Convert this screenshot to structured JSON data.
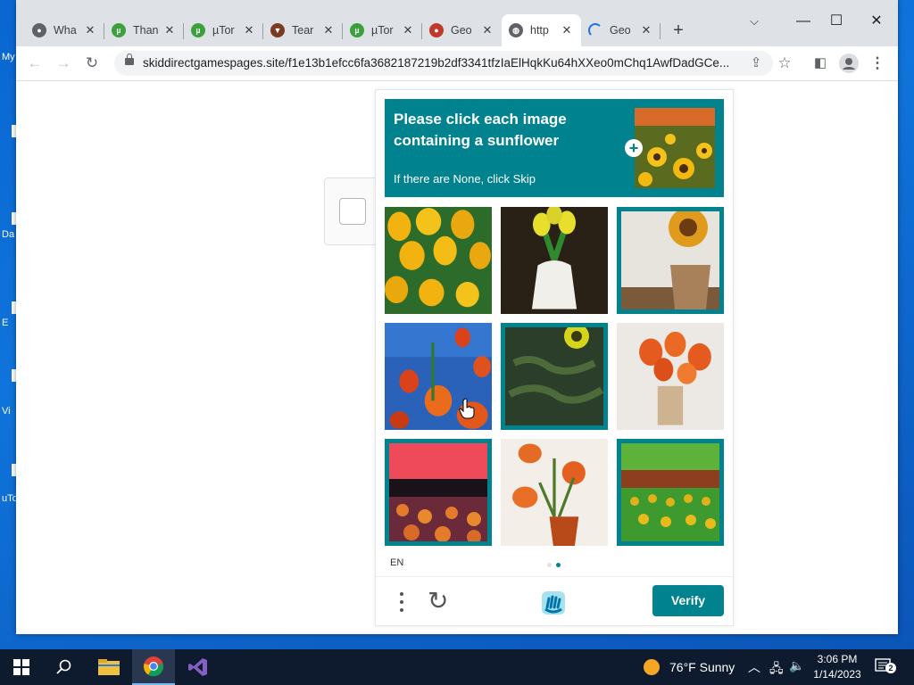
{
  "desktop": {
    "labels": [
      "My",
      "Da",
      "E",
      "Vi",
      "uTo"
    ]
  },
  "browser": {
    "tabs": [
      {
        "label": "Wha",
        "icon": "chrome-icon",
        "color": "#5f6368",
        "active": false
      },
      {
        "label": "Than",
        "icon": "utorrent-icon",
        "color": "#3ca13c",
        "active": false
      },
      {
        "label": "µTor",
        "icon": "utorrent-icon",
        "color": "#3ca13c",
        "active": false
      },
      {
        "label": "Tear",
        "icon": "tearer-icon",
        "color": "#7a3b20",
        "active": false
      },
      {
        "label": "µTor",
        "icon": "utorrent-icon",
        "color": "#3ca13c",
        "active": false
      },
      {
        "label": "Geo",
        "icon": "geo-icon",
        "color": "#c0392b",
        "active": false
      },
      {
        "label": "http",
        "icon": "globe-icon",
        "color": "#5f6368",
        "active": true
      },
      {
        "label": "Geo",
        "icon": "loading-icon",
        "color": "#1a73e8",
        "active": false
      }
    ],
    "url": "skiddirectgamespages.site/f1e13b1efcc6fa3682187219b2df3341tfzIaElHqkKu64hXXeo0mChq1AwfDadGCe..."
  },
  "captcha": {
    "prompt_line": "Please click each image containing a sunflower",
    "prompt_sub": "If there are None, click Skip",
    "grid": [
      {
        "subject": "yellow-tulips",
        "selected": false
      },
      {
        "subject": "tulips-in-white-vase",
        "selected": false
      },
      {
        "subject": "sunflower-in-pot",
        "selected": true
      },
      {
        "subject": "red-tulips-blue-sky",
        "selected": false
      },
      {
        "subject": "sunflowers-dark-field",
        "selected": true
      },
      {
        "subject": "tulips-in-glass-vase",
        "selected": false
      },
      {
        "subject": "sunflower-field-sunset",
        "selected": true
      },
      {
        "subject": "tulips-in-pot",
        "selected": false
      },
      {
        "subject": "sunflower-field-green",
        "selected": true
      }
    ],
    "language": "EN",
    "page_indicator": {
      "current": 2,
      "total": 2
    },
    "verify_label": "Verify",
    "accent_color": "#00838f"
  },
  "taskbar": {
    "weather": "76°F  Sunny",
    "time": "3:06 PM",
    "date": "1/14/2023",
    "notifications": "2"
  }
}
